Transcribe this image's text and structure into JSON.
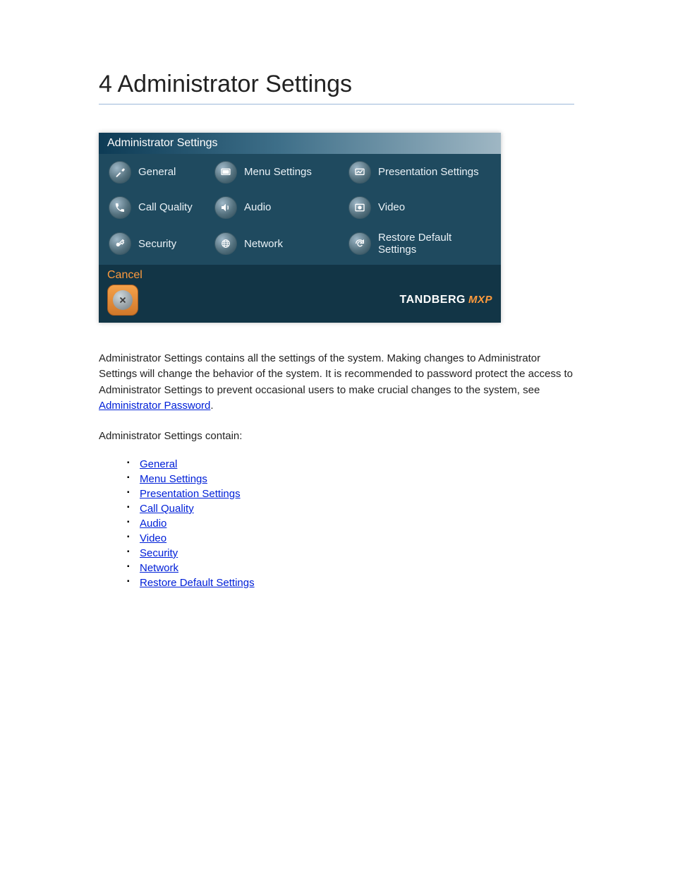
{
  "page": {
    "heading": "4 Administrator Settings"
  },
  "panel": {
    "title": "Administrator Settings",
    "items": [
      {
        "label": "General"
      },
      {
        "label": "Menu Settings"
      },
      {
        "label": "Presentation Settings"
      },
      {
        "label": "Call Quality"
      },
      {
        "label": "Audio"
      },
      {
        "label": "Video"
      },
      {
        "label": "Security"
      },
      {
        "label": "Network"
      },
      {
        "label": "Restore Default Settings"
      }
    ],
    "cancel": "Cancel",
    "brand_main": "TANDBERG",
    "brand_sub": "MXP"
  },
  "text": {
    "p1a": "Administrator Settings contains all the settings of the system. Making changes to Administrator Settings will change the behavior of the system. It is recommended to password protect the access to Administrator Settings to prevent occasional users to make crucial changes to the system, see ",
    "p1_link": "Administrator Password",
    "p1b": ".",
    "p2": "Administrator Settings contain:"
  },
  "links": [
    "General",
    "Menu Settings",
    "Presentation Settings",
    "Call Quality",
    "Audio",
    "Video",
    "Security",
    "Network",
    "Restore Default Settings"
  ]
}
